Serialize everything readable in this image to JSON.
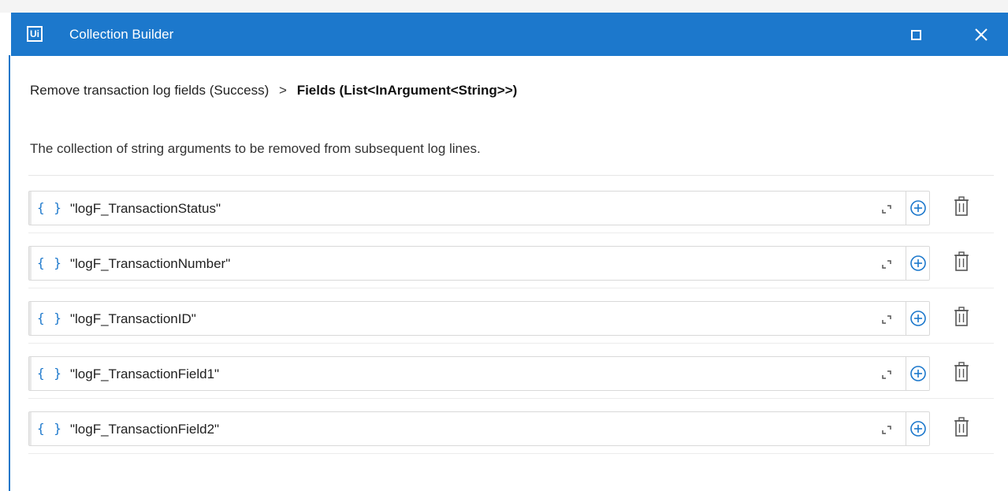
{
  "window": {
    "logo": "Ui",
    "title": "Collection Builder",
    "maximize_icon": "maximize-icon",
    "close_icon": "close-icon"
  },
  "breadcrumb": {
    "parent": "Remove transaction log fields (Success)",
    "separator": ">",
    "current": "Fields (List<InArgument<String>>)"
  },
  "description": "The collection of string arguments to be removed from subsequent log lines.",
  "items": [
    {
      "value": "\"logF_TransactionStatus\""
    },
    {
      "value": "\"logF_TransactionNumber\""
    },
    {
      "value": "\"logF_TransactionID\""
    },
    {
      "value": "\"logF_TransactionField1\""
    },
    {
      "value": "\"logF_TransactionField2\""
    }
  ],
  "item_icons": {
    "braces": "{ }",
    "expand": "expand-icon",
    "add": "add-icon",
    "delete": "trash-icon"
  },
  "colors": {
    "titlebar": "#1c78cc",
    "accent": "#1c78cc"
  }
}
